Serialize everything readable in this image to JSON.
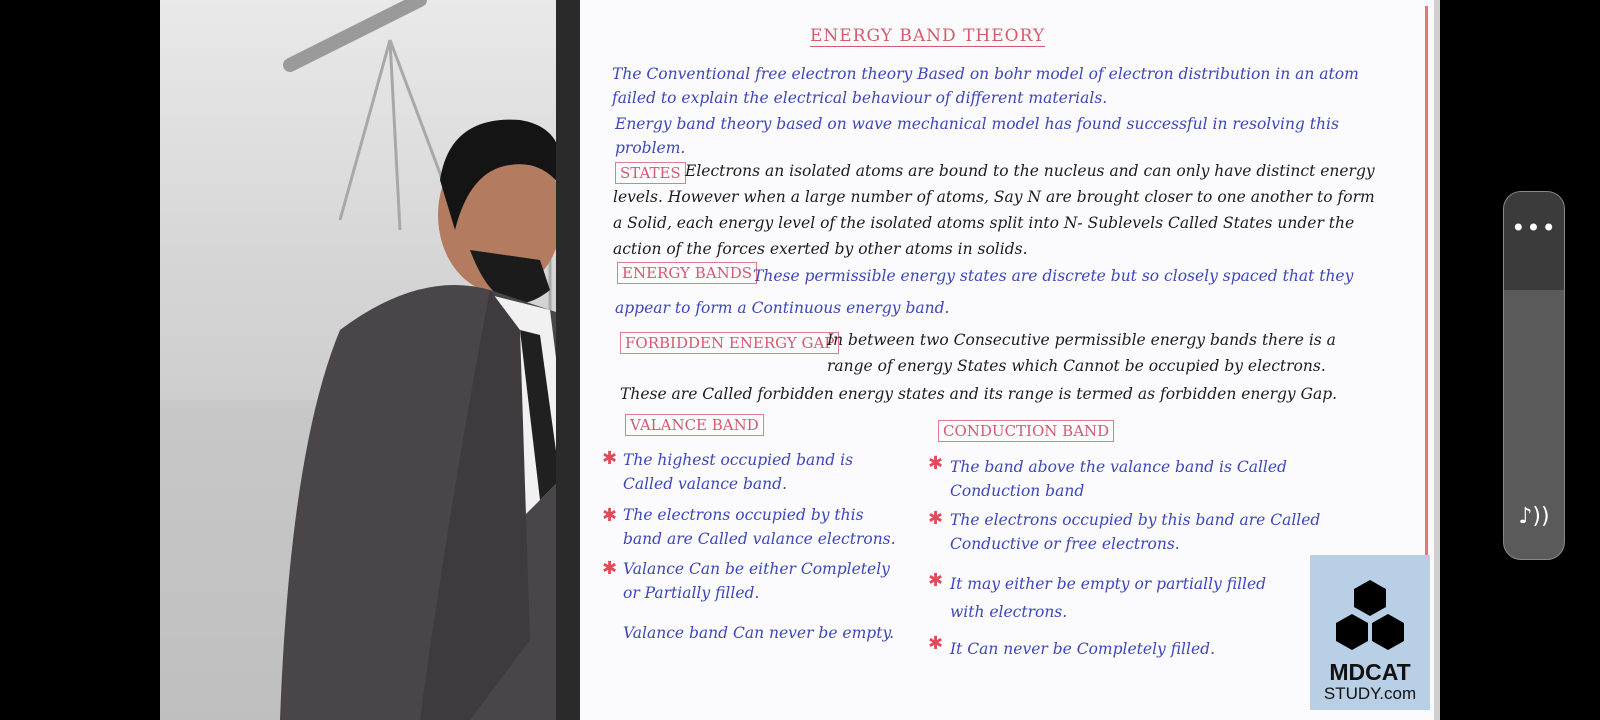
{
  "board": {
    "title": "ENERGY BAND THEORY",
    "intro_1": "The Conventional free electron theory Based on bohr model of electron distribution in an atom failed to explain the electrical behaviour of different materials.",
    "intro_2": "Energy band theory based on wave mechanical model has found successful in resolving this problem.",
    "states_label": "STATES",
    "states_text": "Electrons an isolated atoms are bound to the nucleus and can only have distinct energy levels. However when a large number of atoms, Say N are brought closer to one another to form a Solid, each energy level of the isolated atoms split into N- Sublevels Called States under the action of the forces exerted by other atoms in solids.",
    "energy_bands_label": "ENERGY BANDS",
    "energy_bands_text": "These permissible energy states are discrete but so closely spaced that they appear to form a Continuous energy band.",
    "forbidden_label": "FORBIDDEN ENERGY GAP",
    "forbidden_text": "In between two Consecutive permissible energy bands there is a range of energy States which Cannot be occupied by electrons.",
    "forbidden_text_2": "These are Called forbidden energy states and its range is termed as forbidden energy Gap.",
    "valance_label": "VALANCE BAND",
    "valance_points": [
      "The highest occupied band is Called valance band.",
      "The electrons occupied by this band are Called valance electrons.",
      "Valance Can be either Completely or Partially filled.",
      "Valance band Can never be empty."
    ],
    "conduction_label": "CONDUCTION BAND",
    "conduction_points": [
      "The band above the valance band is Called Conduction band",
      "The electrons occupied by this band are Called Conductive or free electrons.",
      "It may either be empty or partially filled with electrons.",
      "It Can never be Completely filled."
    ]
  },
  "logo": {
    "name": "MDCAT",
    "sub": "STUDY.com"
  },
  "controls": {
    "more": "•••",
    "audio": "♪))"
  }
}
